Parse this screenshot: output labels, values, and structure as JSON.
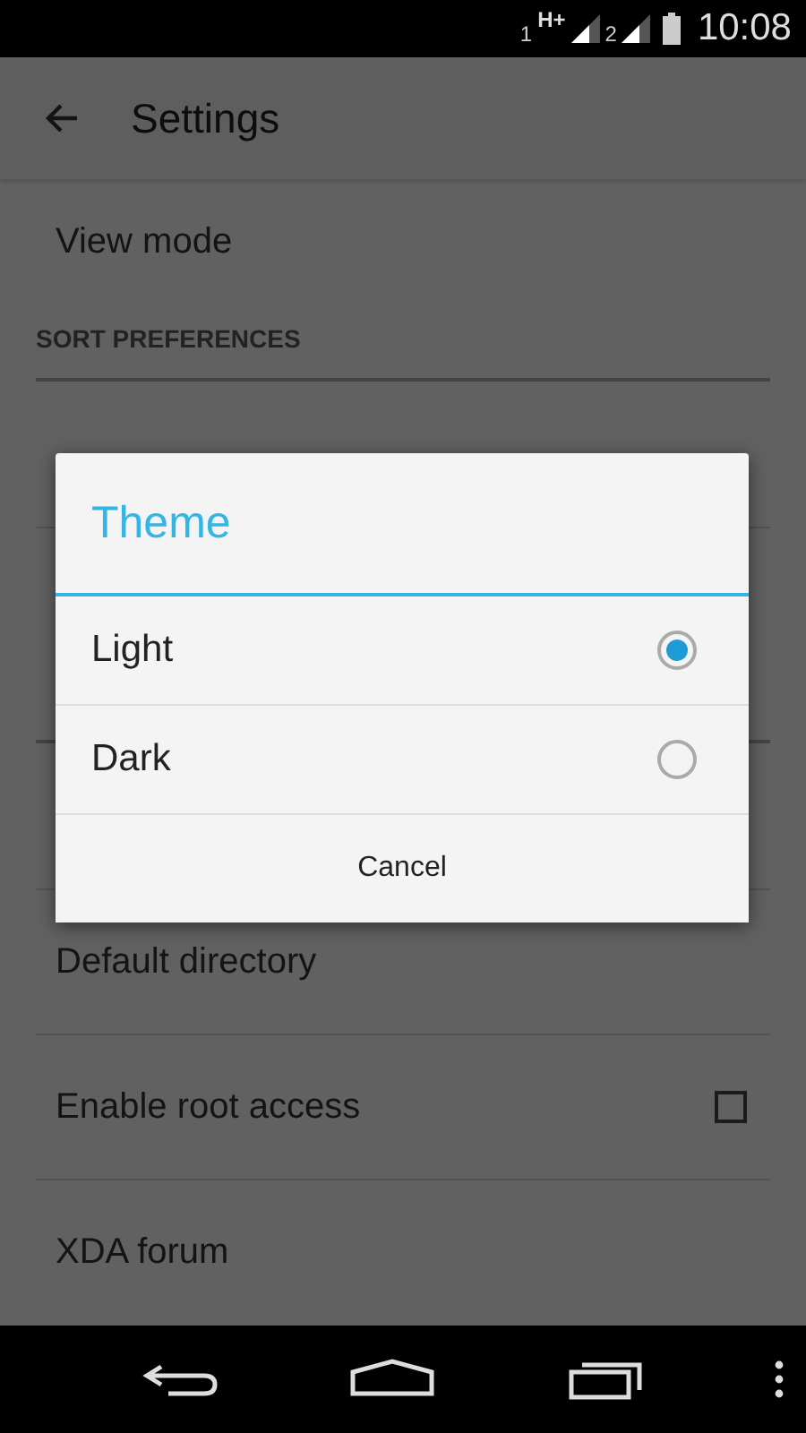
{
  "status_bar": {
    "sim1": "1",
    "network": "H+",
    "sim2": "2",
    "time": "10:08"
  },
  "app_bar": {
    "title": "Settings"
  },
  "settings_top": [
    {
      "kind": "item",
      "label": "View mode"
    },
    {
      "kind": "header",
      "label": "SORT PREFERENCES"
    }
  ],
  "settings_bottom": [
    {
      "kind": "item",
      "label": "Default directory"
    },
    {
      "kind": "checkbox",
      "label": "Enable root access",
      "checked": false
    },
    {
      "kind": "item",
      "label": "XDA forum"
    }
  ],
  "dialog": {
    "title": "Theme",
    "options": [
      {
        "label": "Light",
        "selected": true
      },
      {
        "label": "Dark",
        "selected": false
      }
    ],
    "cancel": "Cancel"
  }
}
